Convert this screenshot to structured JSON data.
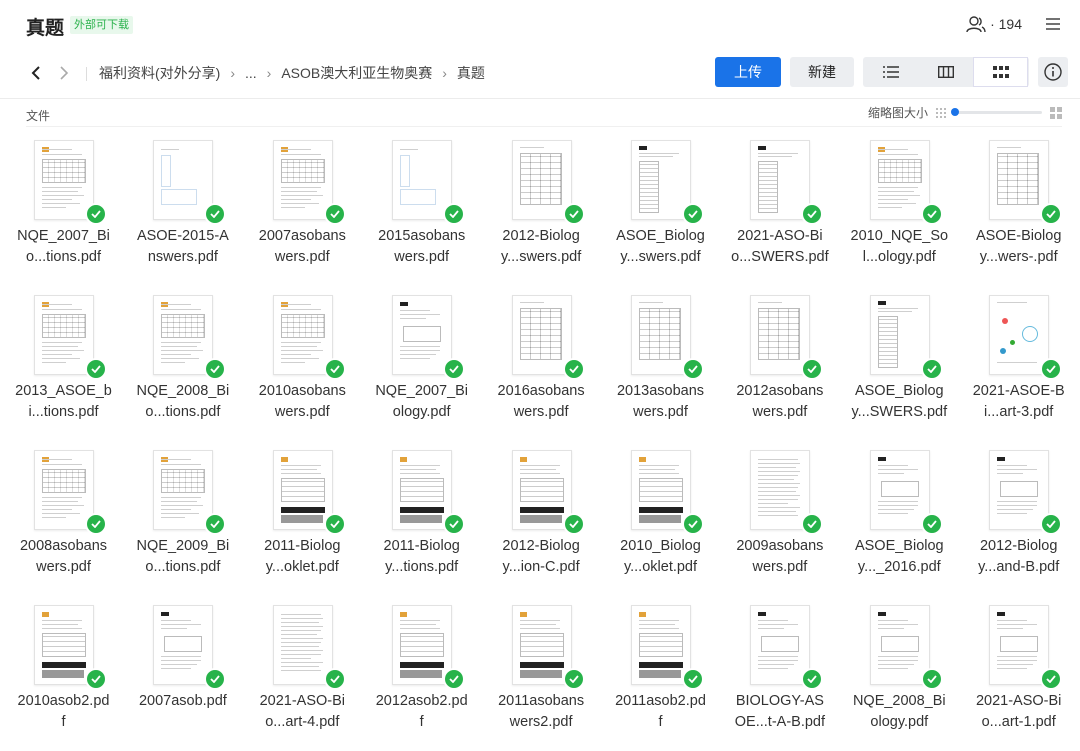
{
  "header": {
    "title": "真题",
    "tag": "外部可下载",
    "member_count": "· 194"
  },
  "breadcrumb": {
    "items": [
      "福利资料(对外分享)",
      "...",
      "ASOB澳大利亚生物奥赛",
      "真题"
    ]
  },
  "toolbar": {
    "upload_label": "上传",
    "new_label": "新建"
  },
  "list": {
    "column_header": "文件",
    "thumb_size_label": "缩略图大小",
    "thumb_size_value": 0
  },
  "colors": {
    "accent": "#1a73e8",
    "check": "#27b34a",
    "tag_text": "#2bb24c"
  },
  "files": [
    {
      "line1": "NQE_2007_Bi",
      "line2": "o...tions.pdf",
      "style": "form"
    },
    {
      "line1": "ASOE-2015-A",
      "line2": "nswers.pdf",
      "style": "answers"
    },
    {
      "line1": "2007asobans",
      "line2": "wers.pdf",
      "style": "form"
    },
    {
      "line1": "2015asobans",
      "line2": "wers.pdf",
      "style": "answers"
    },
    {
      "line1": "2012-Biolog",
      "line2": "y...swers.pdf",
      "style": "table"
    },
    {
      "line1": "ASOE_Biolog",
      "line2": "y...swers.pdf",
      "style": "sheet"
    },
    {
      "line1": "2021-ASO-Bi",
      "line2": "o...SWERS.pdf",
      "style": "sheet"
    },
    {
      "line1": "2010_NQE_So",
      "line2": "l...ology.pdf",
      "style": "form"
    },
    {
      "line1": "ASOE-Biolog",
      "line2": "y...wers-.pdf",
      "style": "table"
    },
    {
      "line1": "2013_ASOE_b",
      "line2": "i...tions.pdf",
      "style": "form"
    },
    {
      "line1": "NQE_2008_Bi",
      "line2": "o...tions.pdf",
      "style": "form"
    },
    {
      "line1": "2010asobans",
      "line2": "wers.pdf",
      "style": "form"
    },
    {
      "line1": "NQE_2007_Bi",
      "line2": "ology.pdf",
      "style": "cover"
    },
    {
      "line1": "2016asobans",
      "line2": "wers.pdf",
      "style": "table"
    },
    {
      "line1": "2013asobans",
      "line2": "wers.pdf",
      "style": "table"
    },
    {
      "line1": "2012asobans",
      "line2": "wers.pdf",
      "style": "table"
    },
    {
      "line1": "ASOE_Biolog",
      "line2": "y...SWERS.pdf",
      "style": "sheet"
    },
    {
      "line1": "2021-ASOE-B",
      "line2": "i...art-3.pdf",
      "style": "diagram"
    },
    {
      "line1": "2008asobans",
      "line2": "wers.pdf",
      "style": "form"
    },
    {
      "line1": "NQE_2009_Bi",
      "line2": "o...tions.pdf",
      "style": "form"
    },
    {
      "line1": "2011-Biolog",
      "line2": "y...oklet.pdf",
      "style": "booklet"
    },
    {
      "line1": "2011-Biolog",
      "line2": "y...tions.pdf",
      "style": "booklet"
    },
    {
      "line1": "2012-Biolog",
      "line2": "y...ion-C.pdf",
      "style": "booklet"
    },
    {
      "line1": "2010_Biolog",
      "line2": "y...oklet.pdf",
      "style": "booklet"
    },
    {
      "line1": "2009asobans",
      "line2": "wers.pdf",
      "style": "text"
    },
    {
      "line1": "ASOE_Biolog",
      "line2": "y..._2016.pdf",
      "style": "cover"
    },
    {
      "line1": "2012-Biolog",
      "line2": "y...and-B.pdf",
      "style": "cover"
    },
    {
      "line1": "2010asob2.pd",
      "line2": "f",
      "style": "booklet"
    },
    {
      "line1": "2007asob.pdf",
      "line2": "",
      "style": "cover"
    },
    {
      "line1": "2021-ASO-Bi",
      "line2": "o...art-4.pdf",
      "style": "text"
    },
    {
      "line1": "2012asob2.pd",
      "line2": "f",
      "style": "booklet"
    },
    {
      "line1": "2011asobans",
      "line2": "wers2.pdf",
      "style": "booklet"
    },
    {
      "line1": "2011asob2.pd",
      "line2": "f",
      "style": "booklet"
    },
    {
      "line1": "BIOLOGY-AS",
      "line2": "OE...t-A-B.pdf",
      "style": "cover"
    },
    {
      "line1": "NQE_2008_Bi",
      "line2": "ology.pdf",
      "style": "cover"
    },
    {
      "line1": "2021-ASO-Bi",
      "line2": "o...art-1.pdf",
      "style": "cover"
    }
  ]
}
